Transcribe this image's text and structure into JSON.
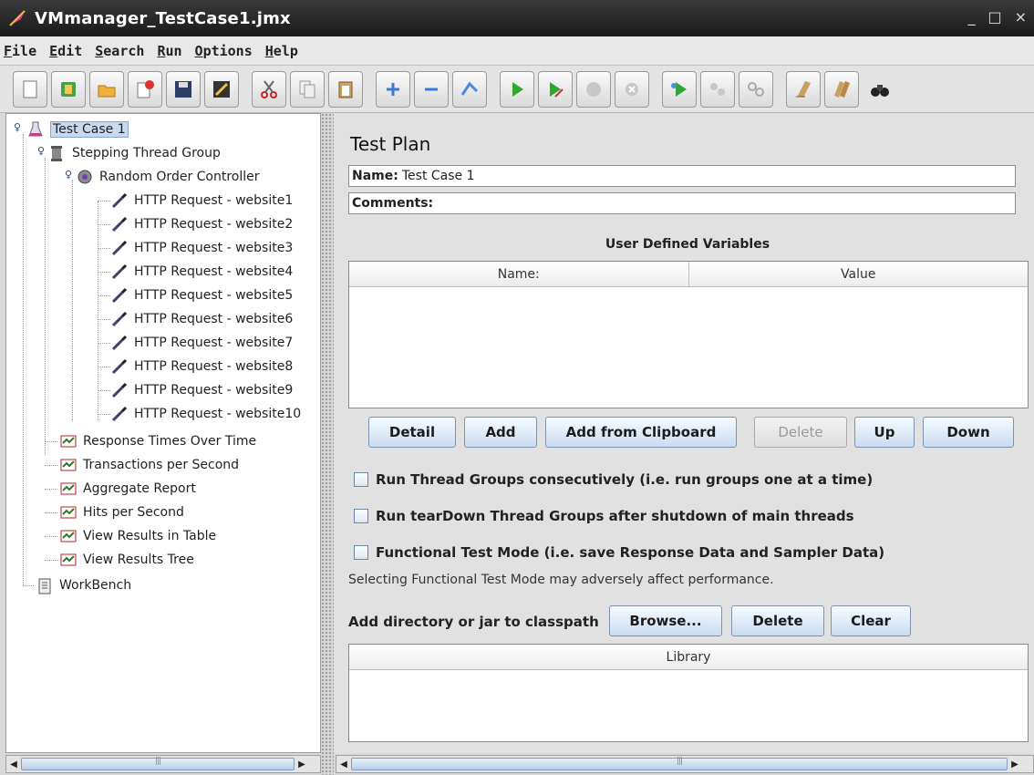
{
  "window": {
    "title": "VMmanager_TestCase1.jmx",
    "controls": [
      "_",
      "□",
      "×"
    ]
  },
  "menu": [
    "File",
    "Edit",
    "Search",
    "Run",
    "Options",
    "Help"
  ],
  "toolbar": [
    "new-icon",
    "templates-icon",
    "open-icon",
    "close-icon",
    "save-icon",
    "save-as-icon",
    "cut-icon",
    "copy-icon",
    "paste-icon",
    "expand-icon",
    "collapse-icon",
    "toggle-icon",
    "start-icon",
    "start-no-timers-icon",
    "stop-icon",
    "shutdown-icon",
    "remote-start-icon",
    "remote-stop-icon",
    "remote-shutdown-icon",
    "clear-icon",
    "clear-all-icon",
    "search-icon"
  ],
  "tree": {
    "root": "Test Case 1",
    "thread_group": "Stepping Thread Group",
    "controller": "Random Order Controller",
    "requests": [
      "HTTP Request - website1",
      "HTTP Request - website2",
      "HTTP Request - website3",
      "HTTP Request - website4",
      "HTTP Request - website5",
      "HTTP Request - website6",
      "HTTP Request - website7",
      "HTTP Request - website8",
      "HTTP Request - website9",
      "HTTP Request - website10"
    ],
    "listeners": [
      "Response Times Over Time",
      "Transactions per Second",
      "Aggregate Report",
      "Hits per Second",
      "View Results in Table",
      "View Results Tree"
    ],
    "workbench": "WorkBench"
  },
  "panel": {
    "title": "Test Plan",
    "name_label": "Name:",
    "name_value": "Test Case 1",
    "comments_label": "Comments:",
    "comments_value": "",
    "udv_title": "User Defined Variables",
    "udv_columns": [
      "Name:",
      "Value"
    ],
    "buttons": {
      "detail": "Detail",
      "add": "Add",
      "add_clipboard": "Add from Clipboard",
      "delete": "Delete",
      "up": "Up",
      "down": "Down"
    },
    "checks": {
      "consecutive": "Run Thread Groups consecutively (i.e. run groups one at a time)",
      "teardown": "Run tearDown Thread Groups after shutdown of main threads",
      "functional": "Functional Test Mode (i.e. save Response Data and Sampler Data)"
    },
    "functional_note": "Selecting Functional Test Mode may adversely affect performance.",
    "classpath_label": "Add directory or jar to classpath",
    "classpath_buttons": {
      "browse": "Browse...",
      "delete": "Delete",
      "clear": "Clear"
    },
    "library_column": "Library"
  }
}
